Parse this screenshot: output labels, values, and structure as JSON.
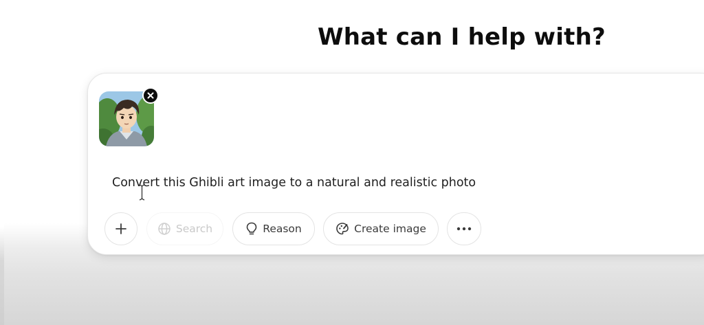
{
  "heading": "What can I help with?",
  "attachment": {
    "name": "ghibli-character-image",
    "remove_icon": "close-icon"
  },
  "prompt": {
    "value": "Convert this Ghibli art image to a natural and realistic photo"
  },
  "toolbar": {
    "attach_icon": "plus-icon",
    "search_label": "Search",
    "search_icon": "globe-icon",
    "reason_label": "Reason",
    "reason_icon": "lightbulb-icon",
    "create_image_label": "Create image",
    "create_image_icon": "palette-icon",
    "more_icon": "ellipsis-icon"
  },
  "colors": {
    "text_primary": "#0d0d0d",
    "button_border": "#e3e3e3",
    "search_disabled": "#c9c9c9"
  }
}
